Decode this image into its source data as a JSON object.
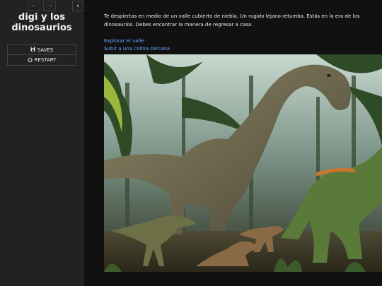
{
  "sidebar": {
    "history_back_icon": "arrow-left-icon",
    "history_forward_icon": "arrow-right-icon",
    "stow_icon": "chevron-left-icon",
    "title_line1": "digi y los",
    "title_line2": "dinosaurios",
    "menu": [
      {
        "icon": "save-icon",
        "label": "SAVES"
      },
      {
        "icon": "power-icon",
        "label": "RESTART"
      }
    ]
  },
  "passage": {
    "text": "Te despiertas en medio de un valle cubierto de niebla. Un rugido lejano retumba. Estás en la era de los dinosaurios. Debes encontrar la manera de regresar a casa.",
    "links": [
      "Explorar el valle",
      "Subir a una colina cercana"
    ]
  },
  "colors": {
    "sidebar_bg": "#222222",
    "page_bg": "#111111",
    "link": "#68a8ff"
  }
}
